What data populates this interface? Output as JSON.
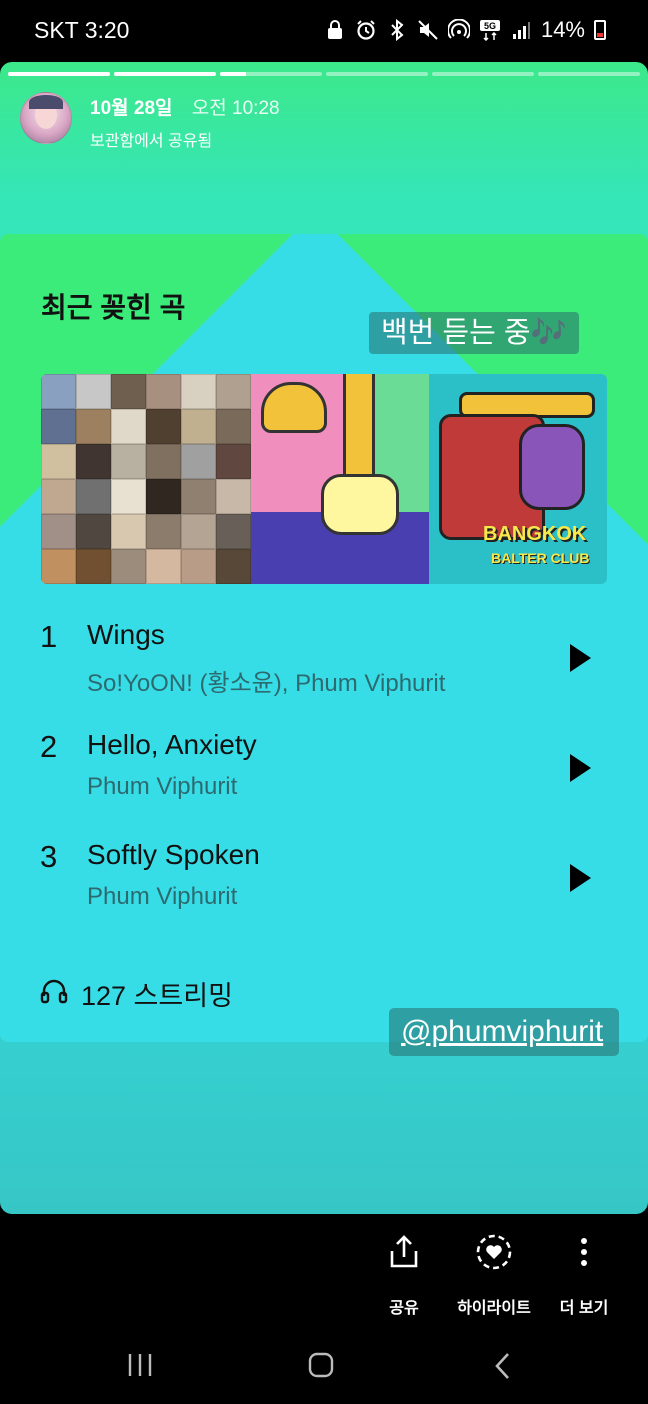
{
  "status_bar": {
    "carrier_time": "SKT 3:20",
    "battery": "14%",
    "network": "5G",
    "icons": [
      "lock-icon",
      "alarm-icon",
      "bluetooth-icon",
      "mute-icon",
      "hotspot-icon",
      "network-5g-icon",
      "signal-icon",
      "battery-icon"
    ]
  },
  "story": {
    "progress": [
      1,
      1,
      0.25,
      0,
      0,
      0
    ],
    "header": {
      "date": "10월 28일",
      "time": "오전 10:28",
      "subtitle": "보관함에서 공유됨"
    },
    "card": {
      "title": "최근 꽂힌 곡",
      "sticker": "백번 듣는 중🎶",
      "tracks": [
        {
          "number": "1",
          "title": "Wings",
          "artist": "So!YoON! (황소윤), Phum Viphurit"
        },
        {
          "number": "2",
          "title": "Hello, Anxiety",
          "artist": "Phum Viphurit"
        },
        {
          "number": "3",
          "title": "Softly Spoken",
          "artist": "Phum Viphurit"
        }
      ],
      "streams": "127 스트리밍",
      "album_logo_line1": "BANGKOK",
      "album_logo_line2": "BALTER CLUB"
    },
    "mention": "@phumviphurit"
  },
  "actions": [
    {
      "label": "공유",
      "icon": "share-icon"
    },
    {
      "label": "하이라이트",
      "icon": "highlight-icon"
    },
    {
      "label": "더 보기",
      "icon": "more-icon"
    }
  ],
  "colors": {
    "bg_green": "#3cec7a",
    "bg_cyan": "#37dde6",
    "sticker_bg": "#3a8f92"
  }
}
